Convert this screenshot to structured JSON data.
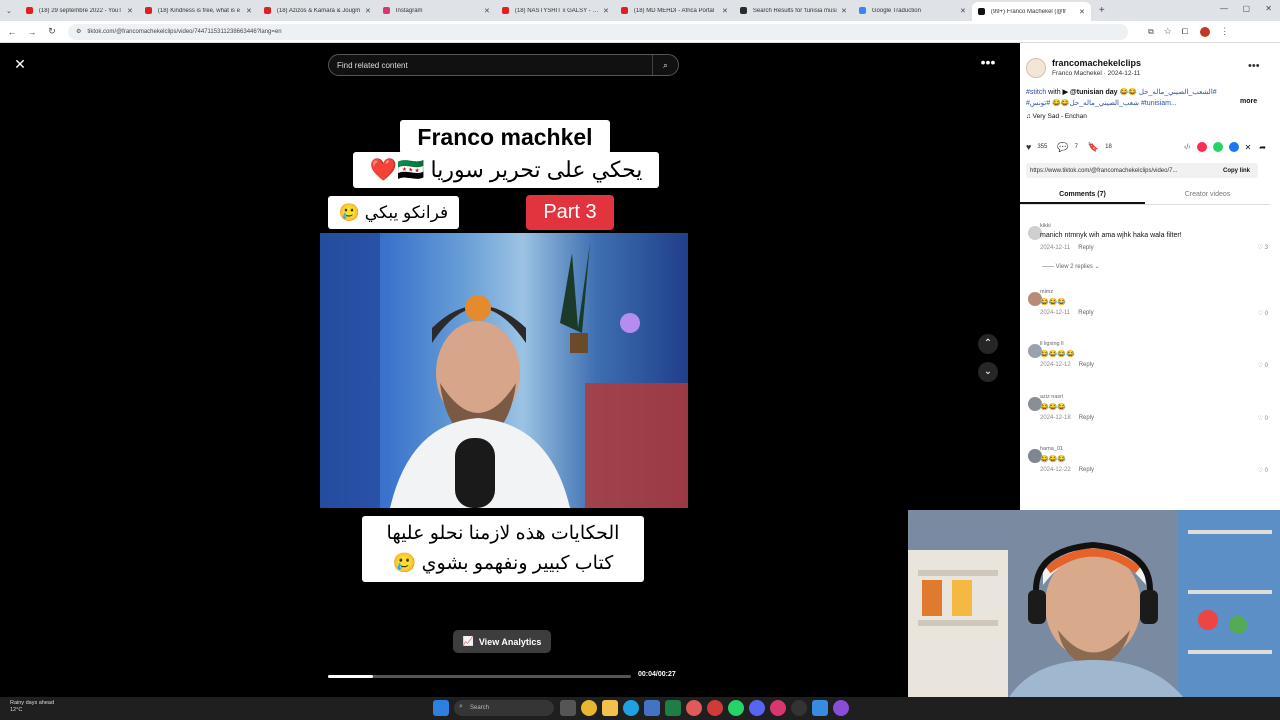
{
  "browser": {
    "tabs": [
      {
        "label": "(18) 29 septembre 2022 - YouT",
        "color": "#e02020"
      },
      {
        "label": "(18) Kindness is free, what is e",
        "color": "#e02020"
      },
      {
        "label": "(18) Azizos & Kamara & Jougm",
        "color": "#e02020"
      },
      {
        "label": "Instagram",
        "color": "#d6376f"
      },
      {
        "label": "(18) NASTYSHIT x GALSY - Nz",
        "color": "#e02020"
      },
      {
        "label": "(18) MD MEHDI - Africa Portal",
        "color": "#e02020"
      },
      {
        "label": "Search Results for 'tunisia musi",
        "color": "#2a2a2a"
      },
      {
        "label": "Google Traduction",
        "color": "#3b82f6"
      },
      {
        "label": "(99+) Franco Machekel (@fr",
        "color": "#111111"
      }
    ],
    "url": "tiktok.com/@francomachekelclips/video/7447115311238663446?lang=en"
  },
  "video": {
    "search_placeholder": "Find related content",
    "caption_title": "Franco machkel",
    "caption_ar1": "يحكي على تحرير سوريا 🇸🇾❤️",
    "caption_ar2": "فرانكو يبكي 🥲",
    "caption_part": "Part 3",
    "caption_bottom_1": "الحكايات هذه لازمنا نحلو عليها",
    "caption_bottom_2": "كتاب كبيير ونفهمو بشوي 🥲",
    "analytics_label": "View Analytics",
    "time": "00:04/00:27",
    "progress": 0.15
  },
  "panel": {
    "username": "francomachekelclips",
    "subline": "Franco Machekel · 2024-12-11",
    "desc_line1_tag": "#stitch",
    "desc_line1_mid": " with ",
    "desc_line1_user": "▶ @tunisian day",
    "desc_line1_tag2": "#الشعب_الصيني_ماله_حل 😂😂",
    "desc_line2": "#شعب_الصيني_ماله_حل😂😂 #تونس #tunisiam...",
    "desc_more": "more",
    "music": "♫ Very Sad - Enchan",
    "likes": "355",
    "comments_count": "7",
    "saves": "18",
    "link": "https://www.tiktok.com/@francomachekelclips/video/7...",
    "copy_link": "Copy link",
    "tab_comments": "Comments (7)",
    "tab_creator": "Creator videos",
    "view_replies": "—— View 2 replies ⌄",
    "reply_label": "Reply",
    "comments": [
      {
        "user": "kikki",
        "text": "manich ntmnyk wih ama wjhk haka wala filter!",
        "date": "2024-12-11",
        "likes": "3"
      },
      {
        "user": "mimz",
        "text": "😂😂😂",
        "date": "2024-12-11",
        "likes": "0"
      },
      {
        "user": "ll ligxing ll",
        "text": "😂😂😂😂",
        "date": "2024-12-12",
        "likes": "0"
      },
      {
        "user": "aziz nasri",
        "text": "😂😂😂",
        "date": "2024-12-18",
        "likes": "0"
      },
      {
        "user": "hama_01",
        "text": "😂😂😂",
        "date": "2024-12-22",
        "likes": "0"
      }
    ]
  },
  "taskbar": {
    "weather_line1": "Rainy days ahead",
    "weather_line2": "12°C",
    "search_label": "Search"
  }
}
